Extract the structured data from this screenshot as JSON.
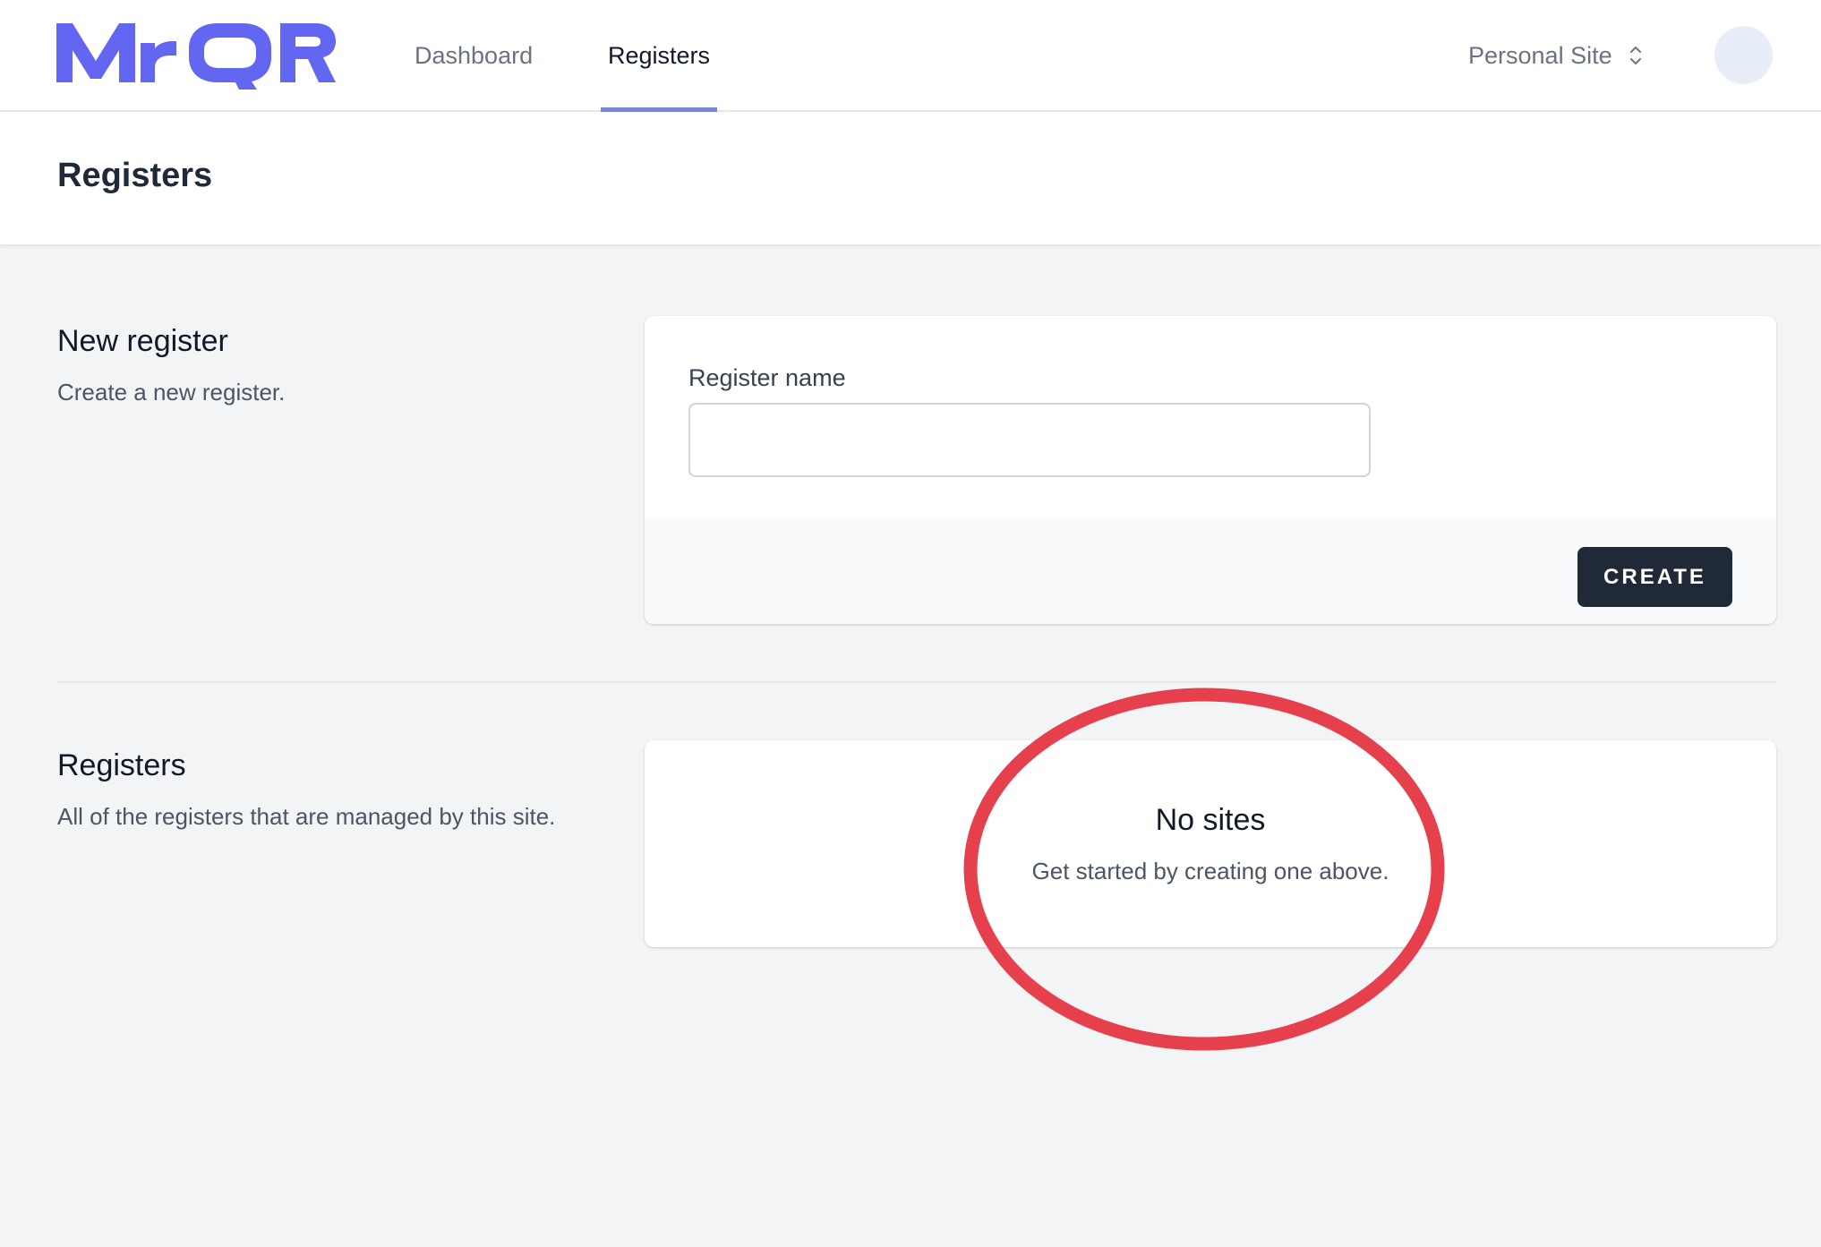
{
  "brand": {
    "logo_text": "MrQR",
    "color": "#6366f1"
  },
  "nav": {
    "items": [
      {
        "label": "Dashboard",
        "active": false
      },
      {
        "label": "Registers",
        "active": true
      }
    ],
    "active_underline_color": "#7c84d8"
  },
  "site_switcher": {
    "label": "Personal Site",
    "icon": "chevron-up-down-icon"
  },
  "user": {
    "avatar_icon": "avatar"
  },
  "page": {
    "title": "Registers"
  },
  "new_register": {
    "heading": "New register",
    "description": "Create a new register.",
    "field_label": "Register name",
    "field_value": "",
    "field_placeholder": "",
    "create_label": "CREATE"
  },
  "registers_section": {
    "heading": "Registers",
    "description": "All of the registers that are managed by this site.",
    "empty_title": "No sites",
    "empty_description": "Get started by creating one above."
  },
  "annotation": {
    "color": "#e5404c",
    "shape": "ellipse"
  }
}
